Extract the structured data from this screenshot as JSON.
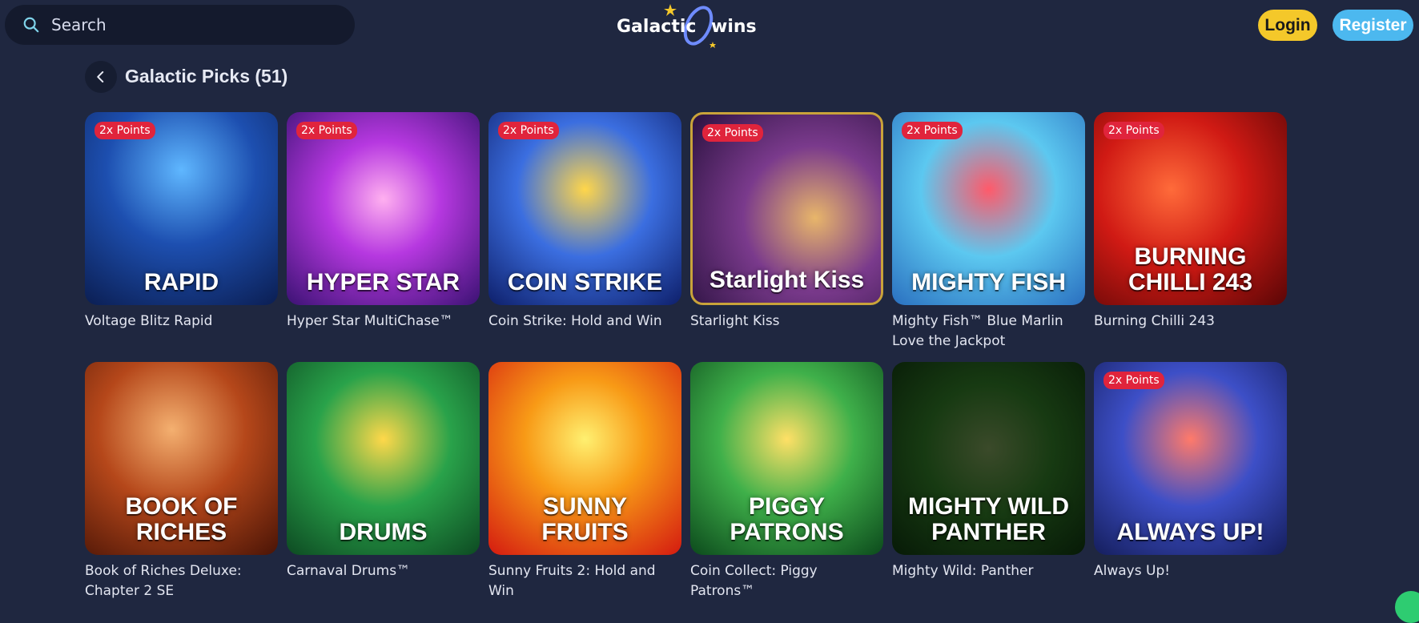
{
  "header": {
    "search_placeholder": "Search",
    "logo_text": "Galactic wins",
    "login_label": "Login",
    "register_label": "Register"
  },
  "page": {
    "title": "Galactic Picks (51)"
  },
  "games": [
    {
      "name": "Voltage Blitz Rapid",
      "tile_title": "RAPID",
      "badge": "2x Points"
    },
    {
      "name": "Hyper Star MultiChase™",
      "tile_title": "HYPER STAR",
      "badge": "2x Points"
    },
    {
      "name": "Coin Strike: Hold and Win",
      "tile_title": "COIN STRIKE",
      "badge": "2x Points"
    },
    {
      "name": "Starlight Kiss",
      "tile_title": "Starlight Kiss",
      "badge": "2x Points"
    },
    {
      "name": "Mighty Fish™ Blue Marlin Love the Jackpot",
      "tile_title": "MIGHTY FISH",
      "badge": "2x Points"
    },
    {
      "name": "Burning Chilli 243",
      "tile_title": "BURNING CHILLI 243",
      "badge": "2x Points"
    },
    {
      "name": "Book of Riches Deluxe: Chapter 2 SE",
      "tile_title": "BOOK OF RICHES",
      "badge": ""
    },
    {
      "name": "Carnaval Drums™",
      "tile_title": "DRUMS",
      "badge": ""
    },
    {
      "name": "Sunny Fruits 2: Hold and Win",
      "tile_title": "SUNNY FRUITS",
      "badge": ""
    },
    {
      "name": "Coin Collect: Piggy Patrons™",
      "tile_title": "PIGGY PATRONS",
      "badge": ""
    },
    {
      "name": "Mighty Wild: Panther",
      "tile_title": "MIGHTY WILD PANTHER",
      "badge": ""
    },
    {
      "name": "Always Up!",
      "tile_title": "ALWAYS UP!",
      "badge": "2x Points"
    }
  ],
  "colors": {
    "background": "#1f2740",
    "login": "#f4c82a",
    "register": "#4cb8ef",
    "badge": "#e0243c"
  }
}
